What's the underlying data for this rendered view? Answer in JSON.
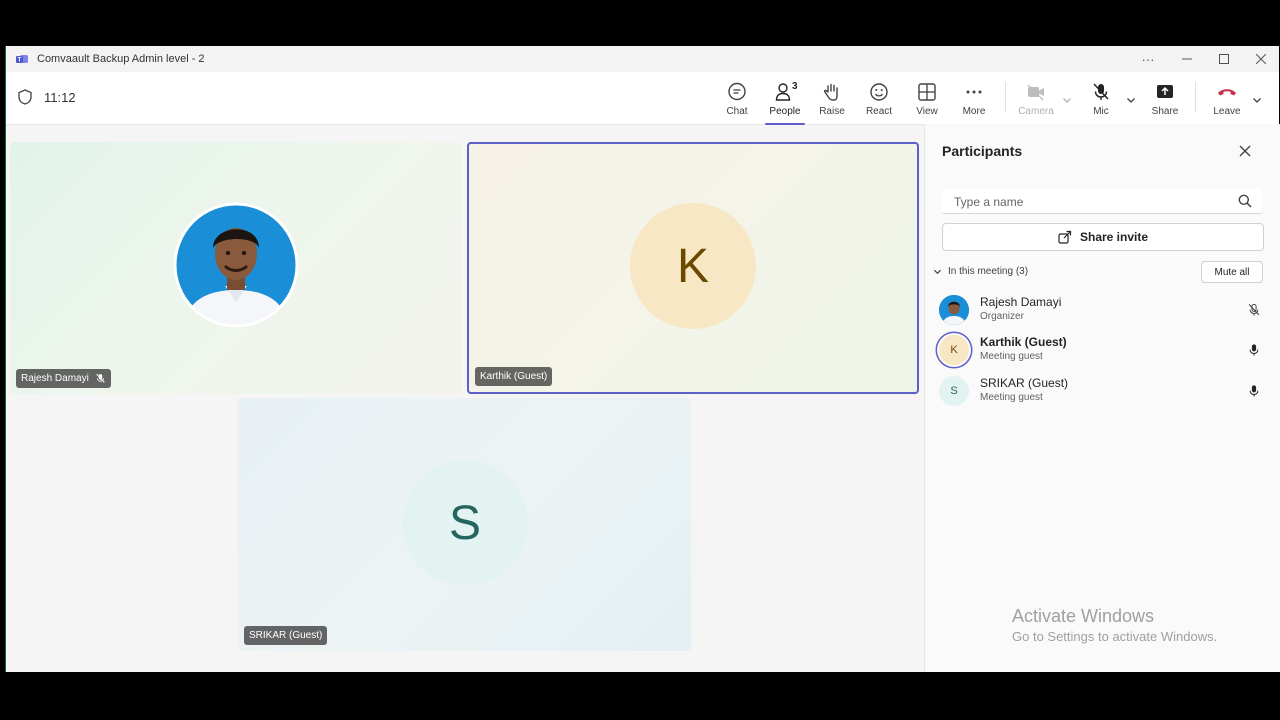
{
  "window": {
    "title": "Comvaault Backup Admin level - 2",
    "controls": [
      "more-options-icon",
      "minimize-icon",
      "maximize-icon",
      "close-icon"
    ]
  },
  "toolbar": {
    "timer": "11:12",
    "chat_label": "Chat",
    "people_label": "People",
    "people_count": "3",
    "raise_label": "Raise",
    "react_label": "React",
    "view_label": "View",
    "more_label": "More",
    "camera_label": "Camera",
    "mic_label": "Mic",
    "share_label": "Share",
    "leave_label": "Leave",
    "active_tab": "People",
    "accent_color": "#5b5fc7",
    "leave_color": "#c4314b"
  },
  "tiles": [
    {
      "name": "Rajesh Damayi",
      "muted": true
    },
    {
      "name": "Karthik (Guest)",
      "initial": "K",
      "highlighted": true
    },
    {
      "name": "SRIKAR (Guest)",
      "initial": "S"
    }
  ],
  "panel": {
    "title": "Participants",
    "search_placeholder": "Type a name",
    "share_invite_label": "Share invite",
    "section_label": "In this meeting (3)",
    "mute_all_label": "Mute all",
    "participants": [
      {
        "name": "Rajesh Damayi",
        "role": "Organizer",
        "mic": "muted"
      },
      {
        "name": "Karthik (Guest)",
        "role": "Meeting guest",
        "initial": "K",
        "mic": "on"
      },
      {
        "name": "SRIKAR (Guest)",
        "role": "Meeting guest",
        "initial": "S",
        "mic": "on"
      }
    ]
  },
  "watermark": {
    "title": "Activate Windows",
    "subtitle": "Go to Settings to activate Windows."
  }
}
